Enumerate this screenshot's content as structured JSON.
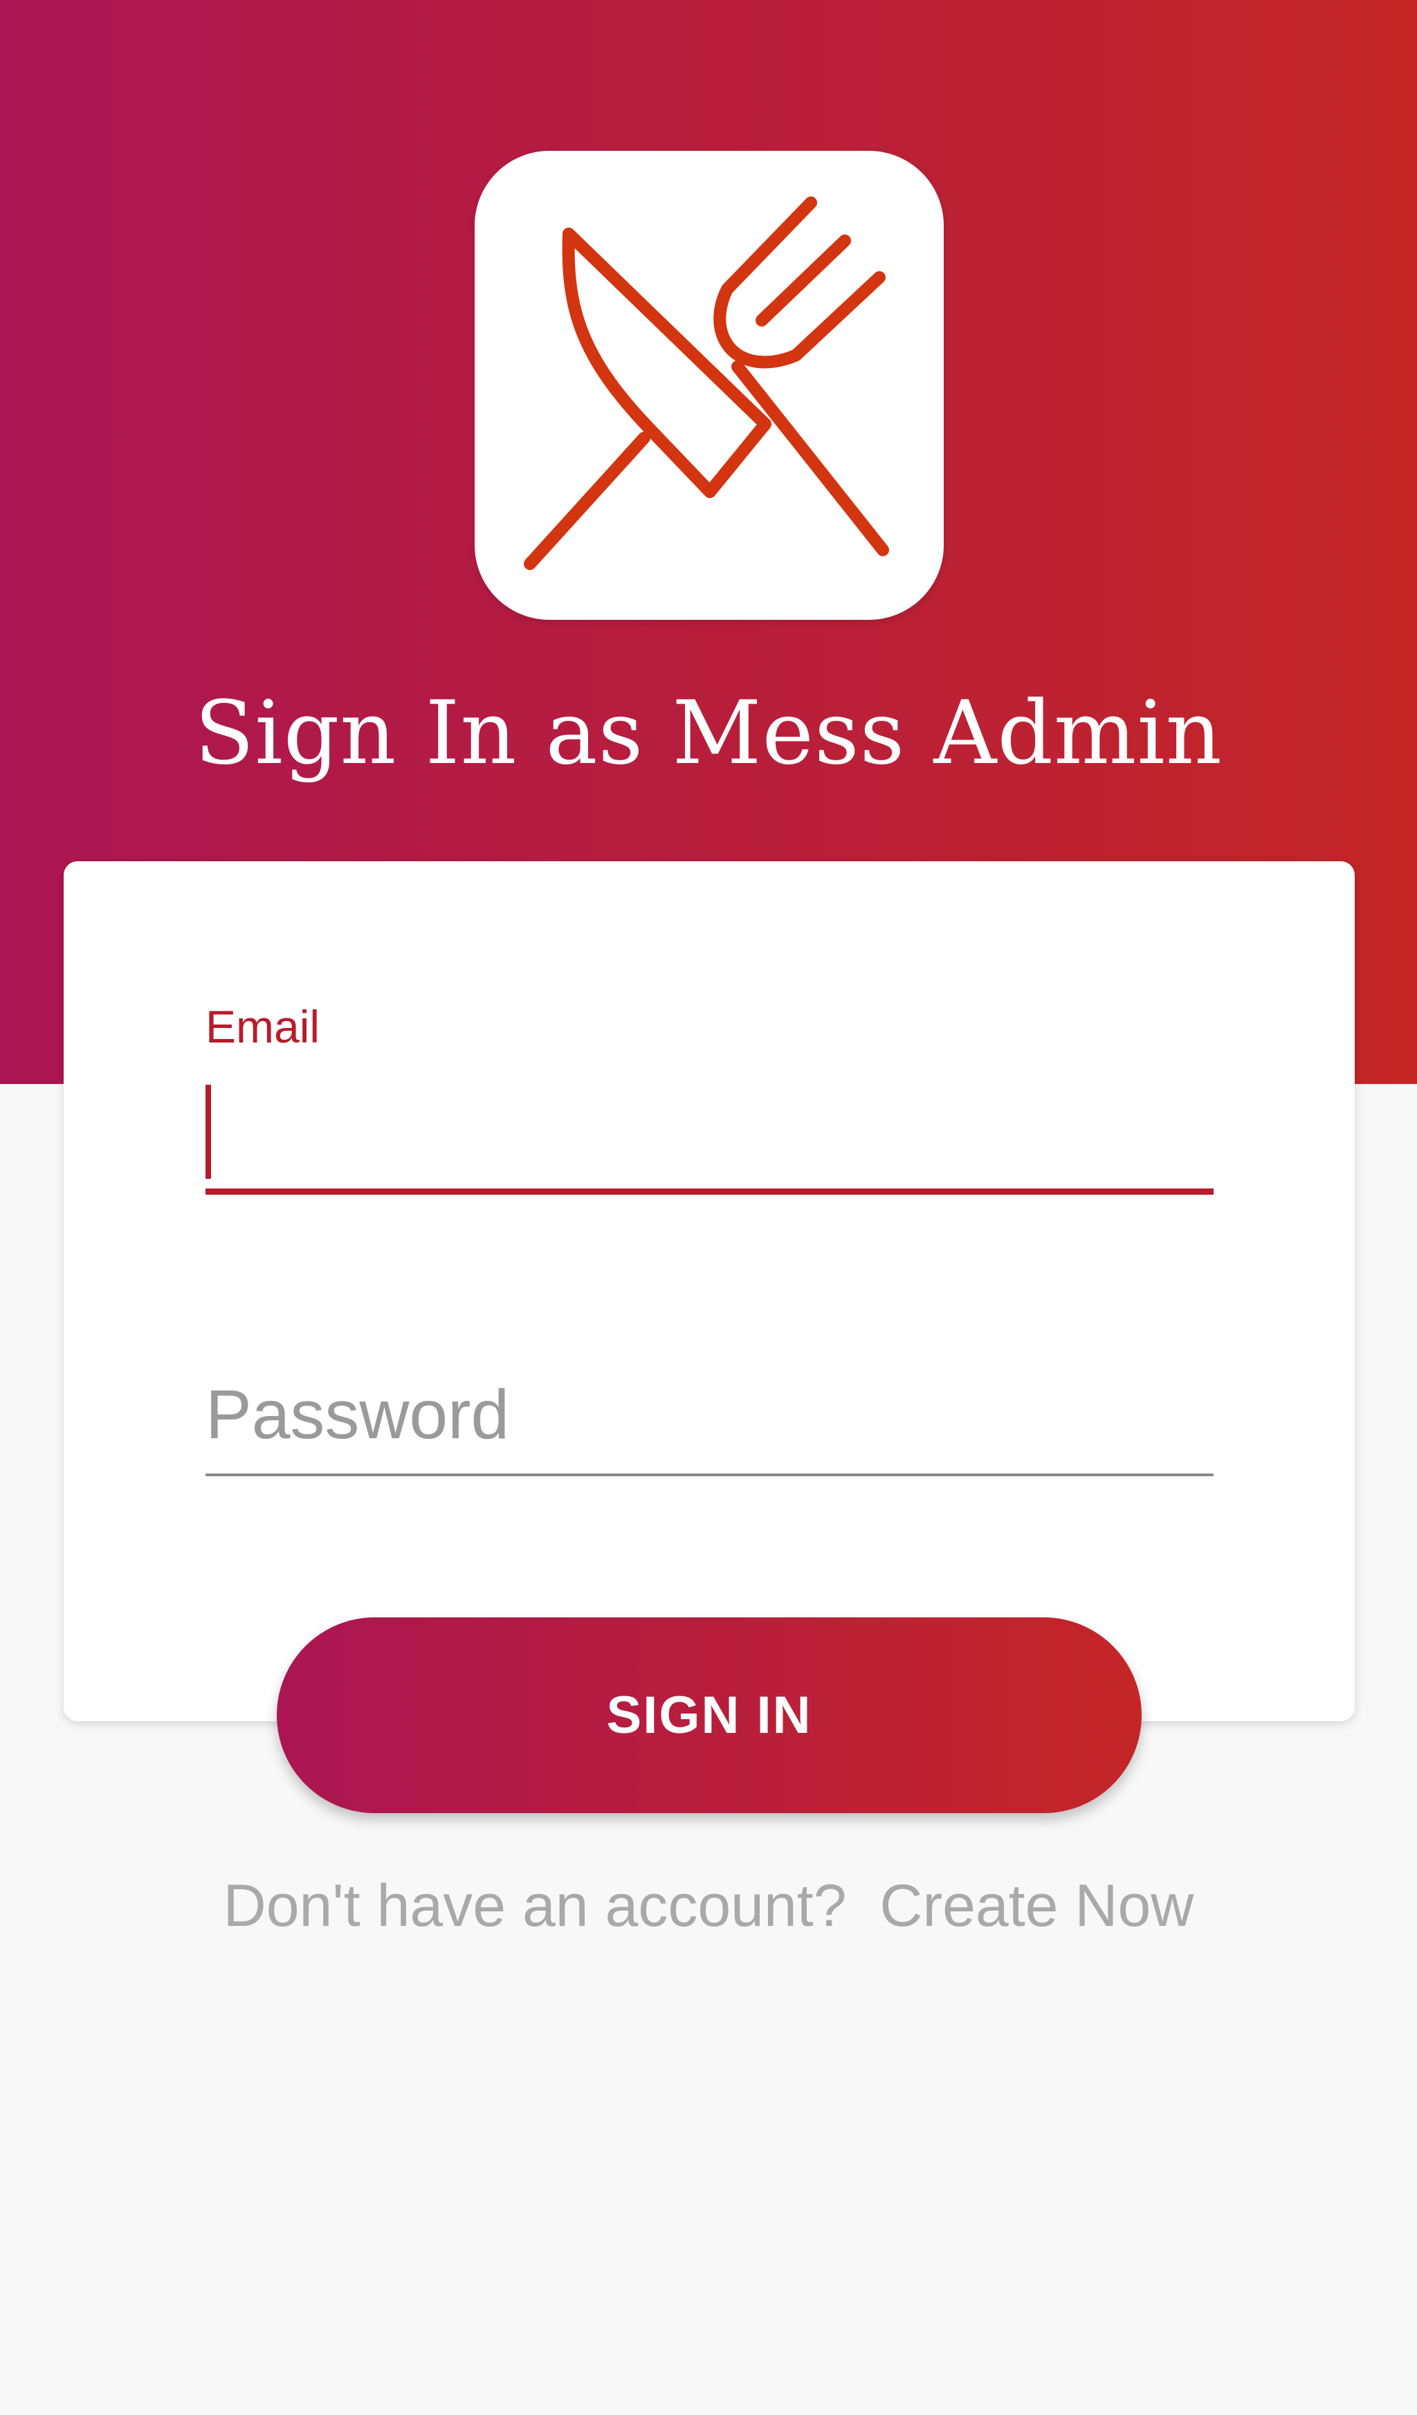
{
  "header": {
    "title": "Sign In as Mess Admin",
    "logo_icon": "fork-knife-icon",
    "gradient_start": "#ab1652",
    "gradient_end": "#c42626"
  },
  "form": {
    "email": {
      "label": "Email",
      "value": ""
    },
    "password": {
      "placeholder": "Password",
      "value": ""
    },
    "accent_color": "#b71c2a"
  },
  "actions": {
    "sign_in_label": "SIGN IN",
    "no_account_text": "Don't have an account?",
    "create_now_label": "Create Now"
  }
}
